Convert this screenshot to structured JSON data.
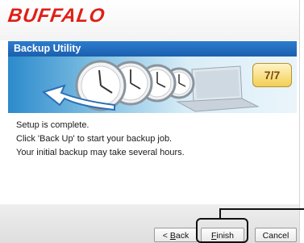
{
  "brand": {
    "logo_text": "BUFFALO",
    "logo_color": "#e01f16"
  },
  "window": {
    "title": "Backup Utility",
    "title_bar_color": "#1b5fae"
  },
  "banner": {
    "step_text": "7/7",
    "icons": [
      "clock-icon",
      "laptop-icon",
      "arrow-icon"
    ]
  },
  "messages": [
    "Setup is complete.",
    "Click 'Back Up' to start your backup job.",
    "Your initial backup may take several hours."
  ],
  "buttons": {
    "back": {
      "prefix": "< ",
      "mnemonic": "B",
      "rest": "ack"
    },
    "finish": {
      "mnemonic": "F",
      "rest": "inish"
    },
    "cancel": {
      "label": "Cancel"
    }
  }
}
